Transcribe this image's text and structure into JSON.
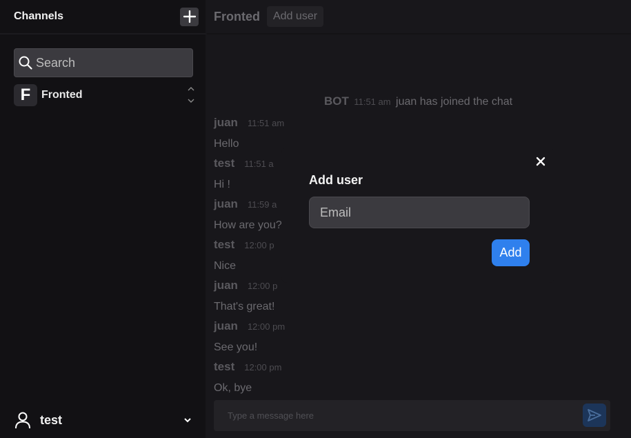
{
  "sidebar": {
    "title": "Channels",
    "add_icon": "plus-icon",
    "search": {
      "placeholder": "Search",
      "value": ""
    },
    "channels": [
      {
        "initial": "F",
        "name": "Fronted"
      }
    ],
    "user": {
      "name": "test"
    }
  },
  "main": {
    "title": "Fronted",
    "add_user_label": "Add user",
    "system_message": {
      "author": "BOT",
      "time": "11:51 am",
      "text": "juan has joined the chat"
    },
    "messages": [
      {
        "author": "juan",
        "time": "11:51 am",
        "text": "Hello"
      },
      {
        "author": "test",
        "time": "11:51 a",
        "text": "Hi !"
      },
      {
        "author": "juan",
        "time": "11:59 a",
        "text": "How are you?"
      },
      {
        "author": "test",
        "time": "12:00 p",
        "text": "Nice"
      },
      {
        "author": "juan",
        "time": "12:00 p",
        "text": "That's great!"
      },
      {
        "author": "juan",
        "time": "12:00 pm",
        "text": "See you!"
      },
      {
        "author": "test",
        "time": "12:00 pm",
        "text": "Ok, bye"
      }
    ],
    "composer": {
      "placeholder": "Type a message here",
      "value": ""
    }
  },
  "modal": {
    "title": "Add user",
    "email_placeholder": "Email",
    "email_value": "",
    "add_label": "Add",
    "close_icon": "close-icon"
  },
  "colors": {
    "background": "#18171b",
    "sidebar": "#121114",
    "input": "#3b3a3f",
    "accent": "#2f80ed"
  }
}
